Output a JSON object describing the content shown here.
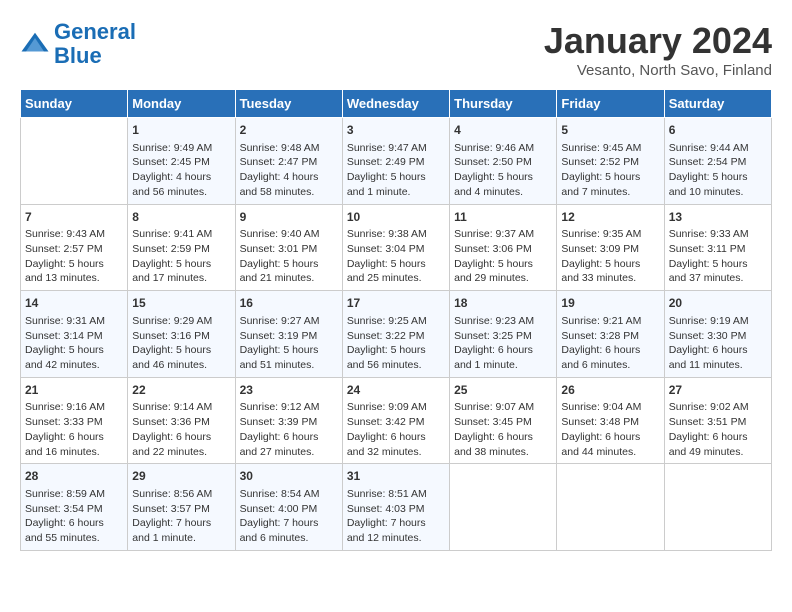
{
  "logo": {
    "line1": "General",
    "line2": "Blue"
  },
  "title": "January 2024",
  "subtitle": "Vesanto, North Savo, Finland",
  "days_of_week": [
    "Sunday",
    "Monday",
    "Tuesday",
    "Wednesday",
    "Thursday",
    "Friday",
    "Saturday"
  ],
  "weeks": [
    [
      {
        "day": "",
        "info": ""
      },
      {
        "day": "1",
        "info": "Sunrise: 9:49 AM\nSunset: 2:45 PM\nDaylight: 4 hours\nand 56 minutes."
      },
      {
        "day": "2",
        "info": "Sunrise: 9:48 AM\nSunset: 2:47 PM\nDaylight: 4 hours\nand 58 minutes."
      },
      {
        "day": "3",
        "info": "Sunrise: 9:47 AM\nSunset: 2:49 PM\nDaylight: 5 hours\nand 1 minute."
      },
      {
        "day": "4",
        "info": "Sunrise: 9:46 AM\nSunset: 2:50 PM\nDaylight: 5 hours\nand 4 minutes."
      },
      {
        "day": "5",
        "info": "Sunrise: 9:45 AM\nSunset: 2:52 PM\nDaylight: 5 hours\nand 7 minutes."
      },
      {
        "day": "6",
        "info": "Sunrise: 9:44 AM\nSunset: 2:54 PM\nDaylight: 5 hours\nand 10 minutes."
      }
    ],
    [
      {
        "day": "7",
        "info": "Sunrise: 9:43 AM\nSunset: 2:57 PM\nDaylight: 5 hours\nand 13 minutes."
      },
      {
        "day": "8",
        "info": "Sunrise: 9:41 AM\nSunset: 2:59 PM\nDaylight: 5 hours\nand 17 minutes."
      },
      {
        "day": "9",
        "info": "Sunrise: 9:40 AM\nSunset: 3:01 PM\nDaylight: 5 hours\nand 21 minutes."
      },
      {
        "day": "10",
        "info": "Sunrise: 9:38 AM\nSunset: 3:04 PM\nDaylight: 5 hours\nand 25 minutes."
      },
      {
        "day": "11",
        "info": "Sunrise: 9:37 AM\nSunset: 3:06 PM\nDaylight: 5 hours\nand 29 minutes."
      },
      {
        "day": "12",
        "info": "Sunrise: 9:35 AM\nSunset: 3:09 PM\nDaylight: 5 hours\nand 33 minutes."
      },
      {
        "day": "13",
        "info": "Sunrise: 9:33 AM\nSunset: 3:11 PM\nDaylight: 5 hours\nand 37 minutes."
      }
    ],
    [
      {
        "day": "14",
        "info": "Sunrise: 9:31 AM\nSunset: 3:14 PM\nDaylight: 5 hours\nand 42 minutes."
      },
      {
        "day": "15",
        "info": "Sunrise: 9:29 AM\nSunset: 3:16 PM\nDaylight: 5 hours\nand 46 minutes."
      },
      {
        "day": "16",
        "info": "Sunrise: 9:27 AM\nSunset: 3:19 PM\nDaylight: 5 hours\nand 51 minutes."
      },
      {
        "day": "17",
        "info": "Sunrise: 9:25 AM\nSunset: 3:22 PM\nDaylight: 5 hours\nand 56 minutes."
      },
      {
        "day": "18",
        "info": "Sunrise: 9:23 AM\nSunset: 3:25 PM\nDaylight: 6 hours\nand 1 minute."
      },
      {
        "day": "19",
        "info": "Sunrise: 9:21 AM\nSunset: 3:28 PM\nDaylight: 6 hours\nand 6 minutes."
      },
      {
        "day": "20",
        "info": "Sunrise: 9:19 AM\nSunset: 3:30 PM\nDaylight: 6 hours\nand 11 minutes."
      }
    ],
    [
      {
        "day": "21",
        "info": "Sunrise: 9:16 AM\nSunset: 3:33 PM\nDaylight: 6 hours\nand 16 minutes."
      },
      {
        "day": "22",
        "info": "Sunrise: 9:14 AM\nSunset: 3:36 PM\nDaylight: 6 hours\nand 22 minutes."
      },
      {
        "day": "23",
        "info": "Sunrise: 9:12 AM\nSunset: 3:39 PM\nDaylight: 6 hours\nand 27 minutes."
      },
      {
        "day": "24",
        "info": "Sunrise: 9:09 AM\nSunset: 3:42 PM\nDaylight: 6 hours\nand 32 minutes."
      },
      {
        "day": "25",
        "info": "Sunrise: 9:07 AM\nSunset: 3:45 PM\nDaylight: 6 hours\nand 38 minutes."
      },
      {
        "day": "26",
        "info": "Sunrise: 9:04 AM\nSunset: 3:48 PM\nDaylight: 6 hours\nand 44 minutes."
      },
      {
        "day": "27",
        "info": "Sunrise: 9:02 AM\nSunset: 3:51 PM\nDaylight: 6 hours\nand 49 minutes."
      }
    ],
    [
      {
        "day": "28",
        "info": "Sunrise: 8:59 AM\nSunset: 3:54 PM\nDaylight: 6 hours\nand 55 minutes."
      },
      {
        "day": "29",
        "info": "Sunrise: 8:56 AM\nSunset: 3:57 PM\nDaylight: 7 hours\nand 1 minute."
      },
      {
        "day": "30",
        "info": "Sunrise: 8:54 AM\nSunset: 4:00 PM\nDaylight: 7 hours\nand 6 minutes."
      },
      {
        "day": "31",
        "info": "Sunrise: 8:51 AM\nSunset: 4:03 PM\nDaylight: 7 hours\nand 12 minutes."
      },
      {
        "day": "",
        "info": ""
      },
      {
        "day": "",
        "info": ""
      },
      {
        "day": "",
        "info": ""
      }
    ]
  ]
}
